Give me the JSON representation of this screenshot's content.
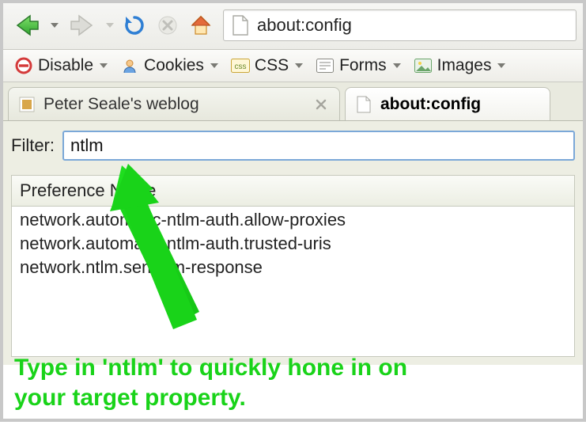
{
  "nav": {
    "url": "about:config"
  },
  "dev_toolbar": {
    "items": [
      {
        "label": "Disable"
      },
      {
        "label": "Cookies"
      },
      {
        "label": "CSS"
      },
      {
        "label": "Forms"
      },
      {
        "label": "Images"
      }
    ]
  },
  "tabs": {
    "inactive": {
      "title": "Peter Seale's weblog"
    },
    "active": {
      "title": "about:config"
    }
  },
  "config": {
    "filter_label": "Filter:",
    "filter_value": "ntlm",
    "column_header": "Preference Name",
    "prefs": [
      "network.automatic-ntlm-auth.allow-proxies",
      "network.automatic-ntlm-auth.trusted-uris",
      "network.ntlm.send-lm-response"
    ]
  },
  "annotation": {
    "line1": "Type in 'ntlm' to quickly hone in on",
    "line2": "your target property."
  }
}
